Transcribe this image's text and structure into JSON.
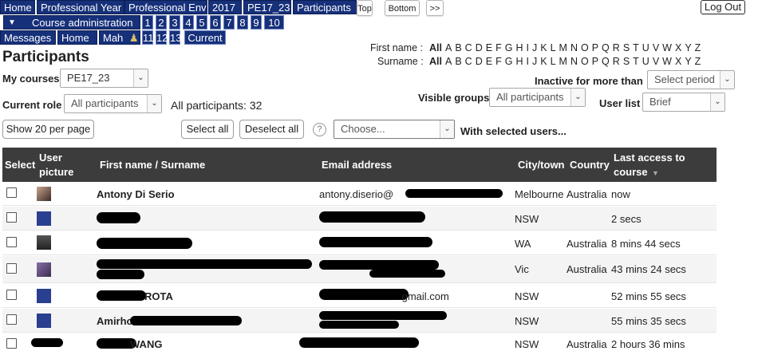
{
  "breadcrumb": [
    "Home",
    "Professional Year",
    "Professional Envi",
    "2017",
    "PE17_23",
    "Participants"
  ],
  "nav_right": {
    "top": "Top",
    "bottom": "Bottom",
    "next": ">>"
  },
  "logout": "Log Out",
  "course_admin": "Course administration",
  "course_numbers": [
    "1",
    "2",
    "3",
    "4",
    "5",
    "6",
    "7",
    "8",
    "9",
    "10"
  ],
  "row3": {
    "messages": "Messages",
    "home": "Home",
    "mah": "Mah",
    "numbers": [
      "11",
      "12",
      "13"
    ],
    "current": "Current"
  },
  "page_title": "Participants",
  "my_courses": {
    "label": "My courses",
    "value": "PE17_23"
  },
  "current_role": {
    "label": "Current role",
    "value": "All participants"
  },
  "all_participants": "All participants: 32",
  "first_name_label": "First name :",
  "surname_label": "Surname :",
  "alphabet": [
    "All",
    "A",
    "B",
    "C",
    "D",
    "E",
    "F",
    "G",
    "H",
    "I",
    "J",
    "K",
    "L",
    "M",
    "N",
    "O",
    "P",
    "Q",
    "R",
    "S",
    "T",
    "U",
    "V",
    "W",
    "X",
    "Y",
    "Z"
  ],
  "inactive": {
    "label": "Inactive for more than",
    "value": "Select period"
  },
  "visible_groups": {
    "label": "Visible groups",
    "value": "All participants"
  },
  "user_list": {
    "label": "User list",
    "value": "Brief"
  },
  "show_per_page": "Show 20 per page",
  "select_all": "Select all",
  "deselect_all": "Deselect all",
  "help_icon": "question-circle-icon",
  "choose": "Choose...",
  "with_selected": "With selected users...",
  "table": {
    "headers": {
      "select": "Select",
      "user_picture_1": "User",
      "user_picture_2": "picture",
      "name": "First name / Surname",
      "email": "Email address",
      "city": "City/town",
      "country": "Country",
      "last_access_1": "Last access to",
      "last_access_2": "course"
    },
    "rows": [
      {
        "name": "Antony Di Serio",
        "email": "antony.diserio@",
        "city": "Melbourne",
        "country": "Australia",
        "last": "now"
      },
      {
        "name": "",
        "email": "",
        "city": "NSW",
        "country": "",
        "last": "2 secs"
      },
      {
        "name": "",
        "email": "",
        "city": "WA",
        "country": "Australia",
        "last": "8 mins 44 secs"
      },
      {
        "name": "",
        "email": "",
        "city": "Vic",
        "country": "Australia",
        "last": "43 mins 24 secs"
      },
      {
        "name": "ROTA",
        "email": ".gmail.com",
        "city": "NSW",
        "country": "",
        "last": "52 mins 55 secs"
      },
      {
        "name": "Amirho",
        "email": "",
        "city": "NSW",
        "country": "",
        "last": "55 mins 35 secs"
      },
      {
        "name": "WANG",
        "email": "",
        "city": "NSW",
        "country": "Australia",
        "last": "2 hours 36 mins"
      }
    ]
  }
}
